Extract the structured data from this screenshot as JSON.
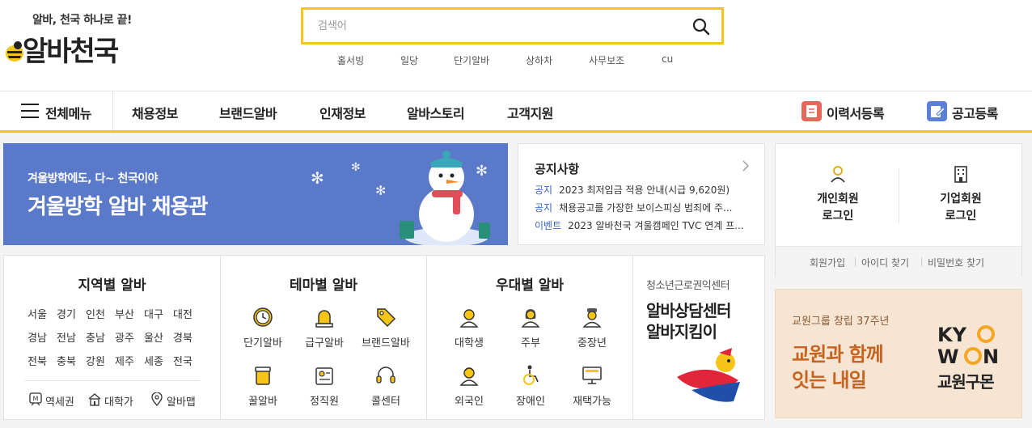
{
  "colors": {
    "accent": "#f5c518",
    "banner": "#5b79c9",
    "link_blue": "#3a64c4",
    "resume_icon": "#e8675b",
    "post_icon": "#5b7fd6",
    "ad_bg": "#f7e5d3",
    "ad_text": "#c56420"
  },
  "header": {
    "logo_tagline": "알바, 천국 하나로 끝!",
    "logo_text": "알바천국",
    "search_placeholder": "검색어",
    "search_icon": "search-icon",
    "keywords": [
      "홀서빙",
      "일당",
      "단기알바",
      "상하차",
      "사무보조",
      "cu"
    ]
  },
  "nav": {
    "menu_label": "전체메뉴",
    "items": [
      "채용정보",
      "브랜드알바",
      "인재정보",
      "알바스토리",
      "고객지원"
    ],
    "resume": "이력서등록",
    "post_job": "공고등록"
  },
  "banner": {
    "subtitle": "겨울방학에도, 다~ 천국이야",
    "title": "겨울방학 알바 채용관"
  },
  "notice": {
    "title": "공지사항",
    "items": [
      {
        "category": "공지",
        "text": "2023 최저임금 적용 안내(시급 9,620원)"
      },
      {
        "category": "공지",
        "text": "채용공고를 가장한 보이스피싱 범죄에 주..."
      },
      {
        "category": "이벤트",
        "text": "2023 알바천국 겨울캠페인 TVC 연계 프..."
      }
    ]
  },
  "login": {
    "personal_l1": "개인회원",
    "personal_l2": "로그인",
    "corp_l1": "기업회원",
    "corp_l2": "로그인",
    "links": [
      "회원가입",
      "아이디 찾기",
      "비밀번호 찾기"
    ]
  },
  "region": {
    "title": "지역별 알바",
    "rows": [
      [
        "서울",
        "경기",
        "인천",
        "부산",
        "대구",
        "대전"
      ],
      [
        "경남",
        "전남",
        "충남",
        "광주",
        "울산",
        "경북"
      ],
      [
        "전북",
        "충북",
        "강원",
        "제주",
        "세종",
        "전국"
      ]
    ],
    "quick": [
      {
        "label": "역세권",
        "icon": "subway-icon"
      },
      {
        "label": "대학가",
        "icon": "school-icon"
      },
      {
        "label": "알바맵",
        "icon": "map-pin-icon"
      }
    ]
  },
  "theme": {
    "title": "테마별 알바",
    "items": [
      {
        "label": "단기알바",
        "icon": "clock-icon"
      },
      {
        "label": "급구알바",
        "icon": "siren-icon"
      },
      {
        "label": "브랜드알바",
        "icon": "tag-icon"
      },
      {
        "label": "꿀알바",
        "icon": "honey-icon"
      },
      {
        "label": "정직원",
        "icon": "id-card-icon"
      },
      {
        "label": "콜센터",
        "icon": "headset-icon"
      }
    ]
  },
  "preferential": {
    "title": "우대별 알바",
    "items": [
      {
        "label": "대학생",
        "icon": "student-icon"
      },
      {
        "label": "주부",
        "icon": "homemaker-icon"
      },
      {
        "label": "중장년",
        "icon": "senior-icon"
      },
      {
        "label": "외국인",
        "icon": "foreigner-icon"
      },
      {
        "label": "장애인",
        "icon": "wheelchair-icon"
      },
      {
        "label": "재택가능",
        "icon": "monitor-icon"
      }
    ]
  },
  "counsel": {
    "subtitle": "청소년근로권익센터",
    "title_l1": "알바상담센터",
    "title_l2": "알바지킴이"
  },
  "ad": {
    "subtitle": "교원그룹 창립 37주년",
    "line1": "교원과 함께",
    "line2": "잇는 내일",
    "logo_l1": "KYO",
    "logo_l2": "WON",
    "brand_kr": "교원구몬"
  }
}
